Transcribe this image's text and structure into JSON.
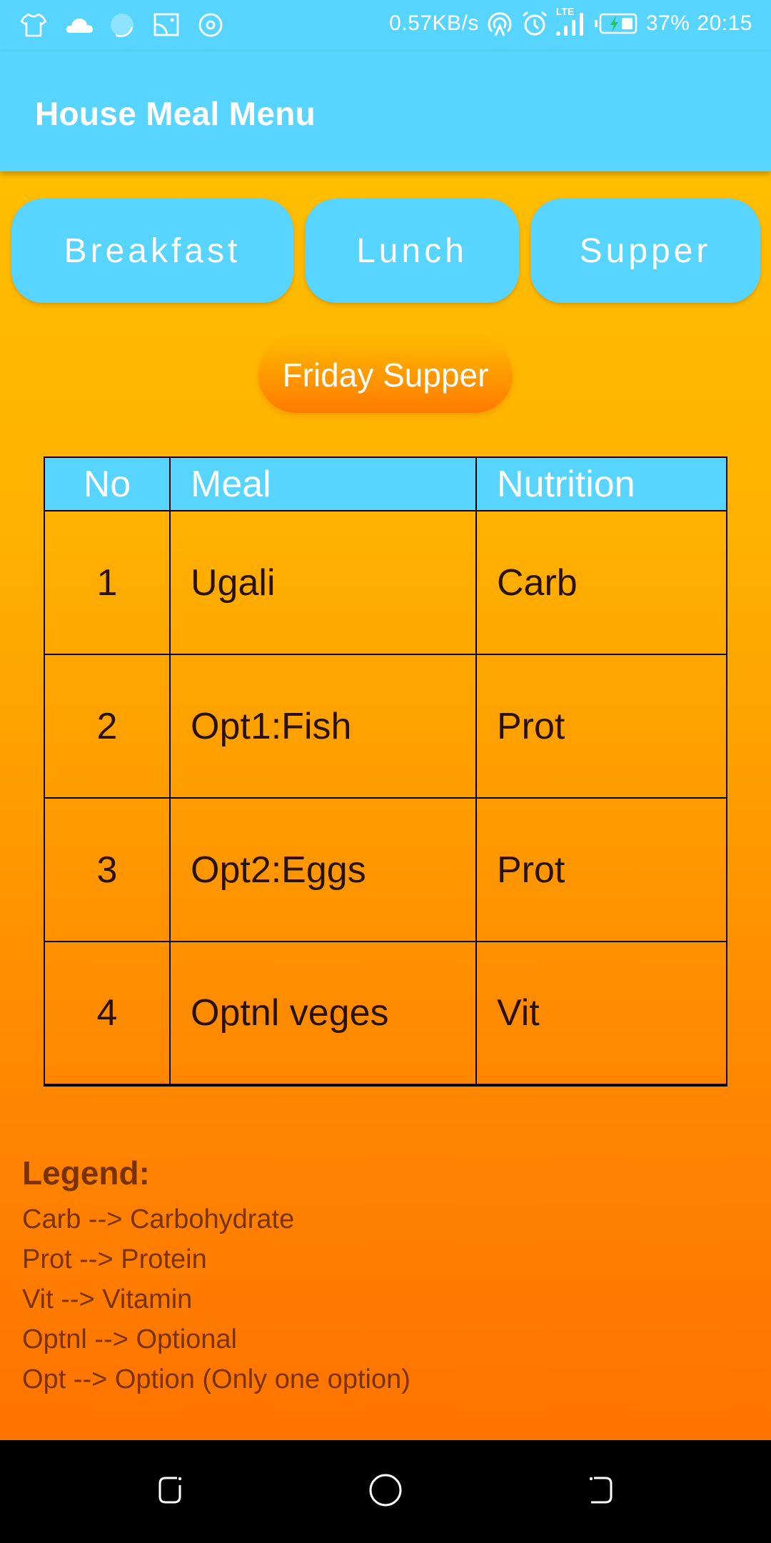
{
  "status_bar": {
    "left_icons": [
      "tshirt-icon",
      "cloud-icon",
      "loading-circle-icon",
      "cast-screen-icon",
      "target-icon"
    ],
    "net_speed": "0.57KB/s",
    "right_icons": [
      "hotspot-icon",
      "alarm-icon",
      "lte-signal-icon",
      "battery-charging-icon"
    ],
    "network_label": "LTE",
    "battery_percent": "37%",
    "time": "20:15"
  },
  "app_bar": {
    "title": "House Meal Menu"
  },
  "meal_tabs": [
    {
      "label": "Breakfast"
    },
    {
      "label": "Lunch"
    },
    {
      "label": "Supper"
    }
  ],
  "selected_meal": "Friday Supper",
  "table": {
    "headers": [
      "No",
      "Meal",
      "Nutrition"
    ],
    "rows": [
      {
        "no": "1",
        "meal": "Ugali",
        "nutrition": "Carb"
      },
      {
        "no": "2",
        "meal": "Opt1:Fish",
        "nutrition": "Prot"
      },
      {
        "no": "3",
        "meal": "Opt2:Eggs",
        "nutrition": "Prot"
      },
      {
        "no": "4",
        "meal": "Optnl veges",
        "nutrition": "Vit"
      }
    ]
  },
  "legend": {
    "title": "Legend:",
    "items": [
      "Carb --> Carbohydrate",
      "Prot --> Protein",
      "Vit --> Vitamin",
      "Optnl --> Optional",
      "Opt --> Option (Only one option)"
    ]
  },
  "colors": {
    "primary_blue": "#57D4FF",
    "gradient_top": "#FFC400",
    "gradient_bottom": "#FF7300",
    "legend_text": "#7A3300",
    "battery_bolt": "#22C55E"
  },
  "nav_bar": {
    "buttons": [
      "back-icon",
      "home-icon",
      "recent-apps-icon"
    ]
  }
}
